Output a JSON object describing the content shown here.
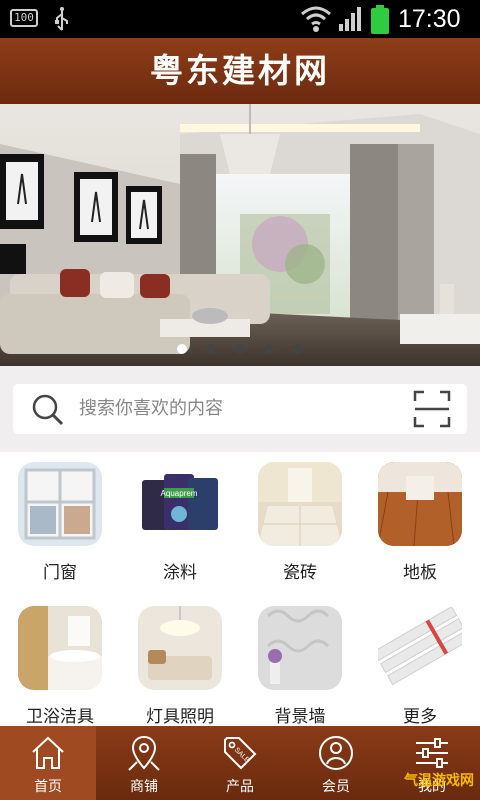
{
  "status_bar": {
    "battery_level": "100",
    "time": "17:30"
  },
  "header": {
    "title": "粤东建材网"
  },
  "banner": {
    "slide_count": 5,
    "active_slide": 1
  },
  "search": {
    "placeholder": "搜索你喜欢的内容"
  },
  "categories": [
    {
      "label": "门窗"
    },
    {
      "label": "涂料"
    },
    {
      "label": "瓷砖"
    },
    {
      "label": "地板"
    },
    {
      "label": "卫浴洁具"
    },
    {
      "label": "灯具照明"
    },
    {
      "label": "背景墙"
    },
    {
      "label": "更多"
    }
  ],
  "tabs": [
    {
      "label": "首页",
      "icon": "home-icon",
      "active": true
    },
    {
      "label": "商铺",
      "icon": "map-pin-icon"
    },
    {
      "label": "产品",
      "icon": "sale-tag-icon"
    },
    {
      "label": "会员",
      "icon": "user-icon"
    },
    {
      "label": "我的",
      "icon": "settings-sliders-icon"
    }
  ],
  "paint_can_text": "Aquaprem",
  "watermark": "气温游戏网"
}
